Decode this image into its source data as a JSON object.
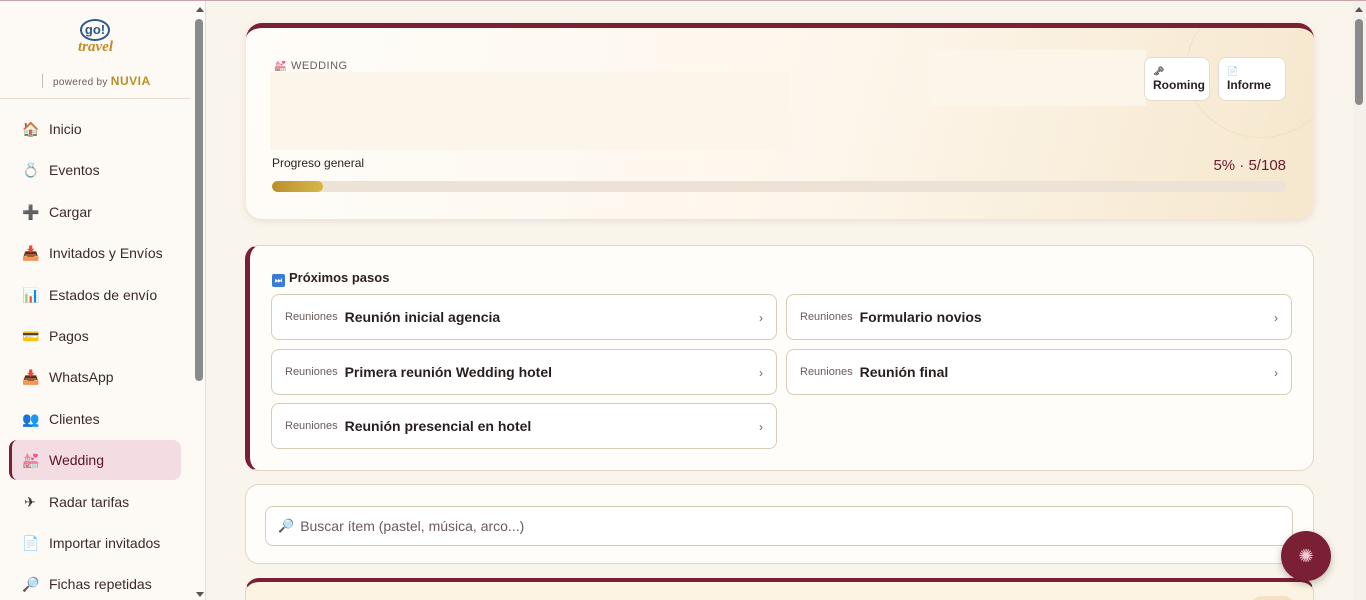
{
  "brand": {
    "logo_go": "go!",
    "logo_travel": "travel",
    "powered_by": "powered by",
    "powered_brand": "NUVIA"
  },
  "nav": [
    {
      "label": "Inicio",
      "icon": "home-icon",
      "glyph": "🏠"
    },
    {
      "label": "Eventos",
      "icon": "ring-icon",
      "glyph": "💍"
    },
    {
      "label": "Cargar",
      "icon": "plus-icon",
      "glyph": "➕"
    },
    {
      "label": "Invitados y Envíos",
      "icon": "inbox-icon",
      "glyph": "📥"
    },
    {
      "label": "Estados de envío",
      "icon": "bar-chart-icon",
      "glyph": "📊"
    },
    {
      "label": "Pagos",
      "icon": "credit-card-icon",
      "glyph": "💳"
    },
    {
      "label": "WhatsApp",
      "icon": "inbox-tray-icon",
      "glyph": "📥"
    },
    {
      "label": "Clientes",
      "icon": "people-icon",
      "glyph": "👥"
    },
    {
      "label": "Wedding",
      "icon": "wedding-icon",
      "glyph": "💒",
      "active": true
    },
    {
      "label": "Radar tarifas",
      "icon": "airplane-icon",
      "glyph": "✈"
    },
    {
      "label": "Importar invitados",
      "icon": "document-icon",
      "glyph": "📄"
    },
    {
      "label": "Fichas repetidas",
      "icon": "magnifier-icon",
      "glyph": "🔎"
    }
  ],
  "hero": {
    "label": "WEDDING",
    "buttons": {
      "rooming": "Rooming",
      "informe": "Informe"
    },
    "progress_label": "Progreso general",
    "progress_text": "5% · 5/108",
    "progress_fraction": 0.05
  },
  "steps": {
    "title": "Próximos pasos",
    "items": [
      {
        "category": "Reuniones",
        "name": "Reunión inicial agencia"
      },
      {
        "category": "Reuniones",
        "name": "Formulario novios"
      },
      {
        "category": "Reuniones",
        "name": "Primera reunión Wedding hotel"
      },
      {
        "category": "Reuniones",
        "name": "Reunión final"
      },
      {
        "category": "Reuniones",
        "name": "Reunión presencial en hotel"
      }
    ]
  },
  "search": {
    "placeholder": "Buscar ítem (pastel, música, arco...)"
  },
  "colors": {
    "accent": "#7a1f34",
    "gold": "#b8902c",
    "background": "#faf5ec"
  }
}
